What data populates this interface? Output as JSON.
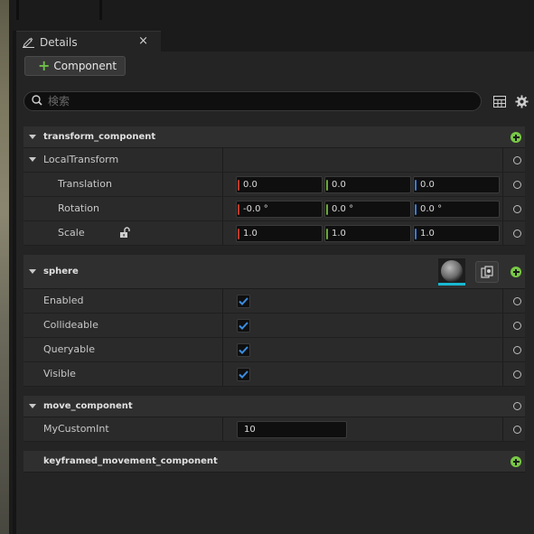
{
  "tab": {
    "title": "Details",
    "close": "×"
  },
  "toolbar": {
    "add_component": "Component",
    "search_placeholder": "検索"
  },
  "sections": {
    "transform": {
      "title": "transform_component",
      "local_transform": "LocalTransform",
      "rows": [
        {
          "label": "Translation",
          "x": "0.0",
          "y": "0.0",
          "z": "0.0"
        },
        {
          "label": "Rotation",
          "x": "-0.0 °",
          "y": "0.0 °",
          "z": "0.0 °"
        },
        {
          "label": "Scale",
          "x": "1.0",
          "y": "1.0",
          "z": "1.0"
        }
      ]
    },
    "sphere": {
      "title": "sphere",
      "rows": [
        {
          "label": "Enabled",
          "checked": true
        },
        {
          "label": "Collideable",
          "checked": true
        },
        {
          "label": "Queryable",
          "checked": true
        },
        {
          "label": "Visible",
          "checked": true
        }
      ]
    },
    "move": {
      "title": "move_component",
      "field_label": "MyCustomInt",
      "field_value": "10"
    },
    "keyframed": {
      "title": "keyframed_movement_component"
    }
  },
  "colors": {
    "x_axis": "#c0392b",
    "y_axis": "#6aa83a",
    "z_axis": "#3a7bd5",
    "accent_plus": "#78c846",
    "check": "#3b8de0"
  }
}
